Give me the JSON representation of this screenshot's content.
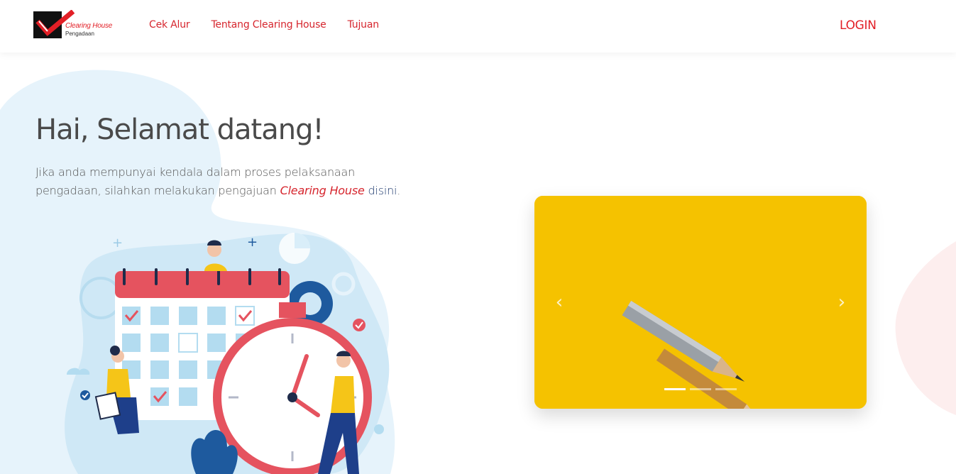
{
  "brand": {
    "name": "Clearing House",
    "subname": "Pengadaan"
  },
  "nav": {
    "links": [
      "Cek Alur",
      "Tentang Clearing House",
      "Tujuan"
    ],
    "login": "LOGIN"
  },
  "hero": {
    "title": "Hai, Selamat datang!",
    "desc_line1": "Jika anda mempunyai kendala dalam proses pelaksanaan",
    "desc_line2_prefix": "pengadaan, silahkan melakukan pengajuan ",
    "desc_line2_em": "Clearing House",
    "desc_line2_link": "disini",
    "desc_line2_suffix": "."
  },
  "carousel": {
    "prev_icon": "chevron-left-icon",
    "next_icon": "chevron-right-icon",
    "indicators": 3,
    "active_index": 0
  },
  "colors": {
    "accent": "#e21f26",
    "carousel_bg": "#f5c200",
    "blob_blue": "#e3f2fb"
  }
}
